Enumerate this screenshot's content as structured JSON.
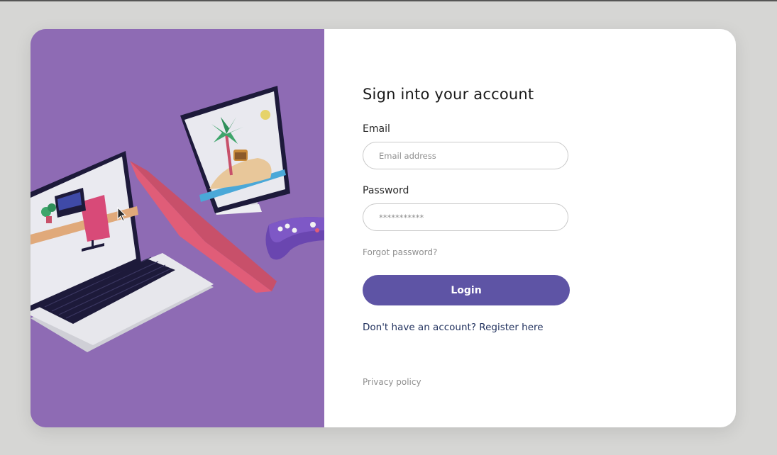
{
  "form": {
    "title": "Sign into your account",
    "email_label": "Email",
    "email_placeholder": "Email address",
    "password_label": "Password",
    "password_placeholder": "***********",
    "forgot_label": "Forgot password?",
    "login_label": "Login",
    "register_prompt": "Don't have an account?",
    "register_link": "Register here",
    "privacy_label": "Privacy policy"
  },
  "illustration": {
    "icons": [
      "laptop-icon",
      "monitor-icon",
      "gamepad-icon",
      "palm-tree-icon",
      "treasure-chest-icon",
      "desk-chair-icon"
    ]
  },
  "colors": {
    "accent": "#5e54a5",
    "illustration_bg": "#8e6bb4",
    "page_bg": "#d6d6d4",
    "link_text": "#1f2f5c"
  }
}
